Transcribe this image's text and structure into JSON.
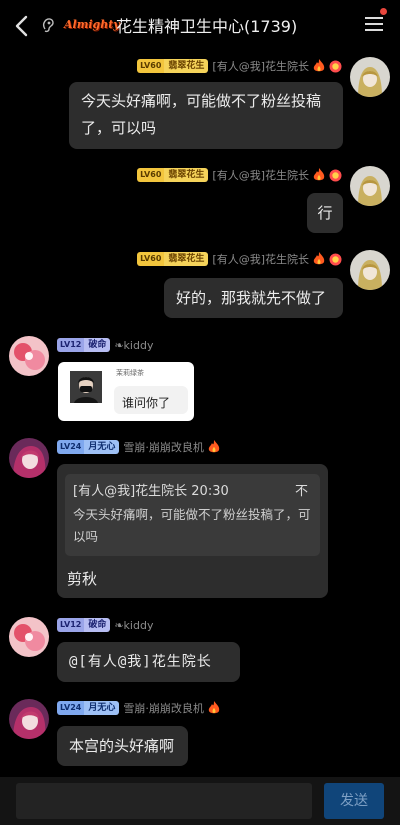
{
  "header": {
    "title": "花生精神卫生中心(1739)",
    "logo_text": "Almighty",
    "notification_dot_color": "#e8453c"
  },
  "messages": [
    {
      "side": "right",
      "badge": {
        "level": "LV60",
        "title": "翡翠花生",
        "style": "gold"
      },
      "sender": "[有人@我]花生院长",
      "text": "今天头好痛啊，可能做不了粉丝投稿了，可以吗",
      "icons": [
        "fire-icon",
        "medal-icon"
      ]
    },
    {
      "side": "right",
      "badge": {
        "level": "LV60",
        "title": "翡翠花生",
        "style": "gold"
      },
      "sender": "[有人@我]花生院长",
      "text": "行",
      "icons": [
        "fire-icon",
        "medal-icon"
      ]
    },
    {
      "side": "right",
      "badge": {
        "level": "LV60",
        "title": "翡翠花生",
        "style": "gold"
      },
      "sender": "[有人@我]花生院长",
      "text": "好的，那我就先不做了",
      "icons": [
        "fire-icon",
        "medal-icon"
      ]
    },
    {
      "side": "left",
      "badge": {
        "level": "LV12",
        "title": "破命",
        "style": "purple"
      },
      "sender": "❧kiddy",
      "image": {
        "caption": "茉莉绿茶",
        "text": "谁问你了"
      }
    },
    {
      "side": "left",
      "badge": {
        "level": "LV24",
        "title": "月无心",
        "style": "blue"
      },
      "sender": "雪崩·崩崩改良机",
      "quote": {
        "head": "[有人@我]花生院长 20:30",
        "close": "不",
        "body": "今天头好痛啊，可能做不了粉丝投稿了，可以吗"
      },
      "text": "剪秋",
      "icons": [
        "fire-icon"
      ]
    },
    {
      "side": "left",
      "badge": {
        "level": "LV12",
        "title": "破命",
        "style": "purple"
      },
      "sender": "❧kiddy",
      "text": "@[有人@我]花生院长"
    },
    {
      "side": "left",
      "badge": {
        "level": "LV24",
        "title": "月无心",
        "style": "blue"
      },
      "sender": "雪崩·崩崩改良机",
      "text": "本宫的头好痛啊",
      "icons": [
        "fire-icon"
      ]
    }
  ],
  "input": {
    "placeholder": "",
    "value": ""
  },
  "send_label": "发送",
  "colors": {
    "background": "#000000",
    "bubble": "#2d2d2d",
    "send_button": "#10457a"
  }
}
